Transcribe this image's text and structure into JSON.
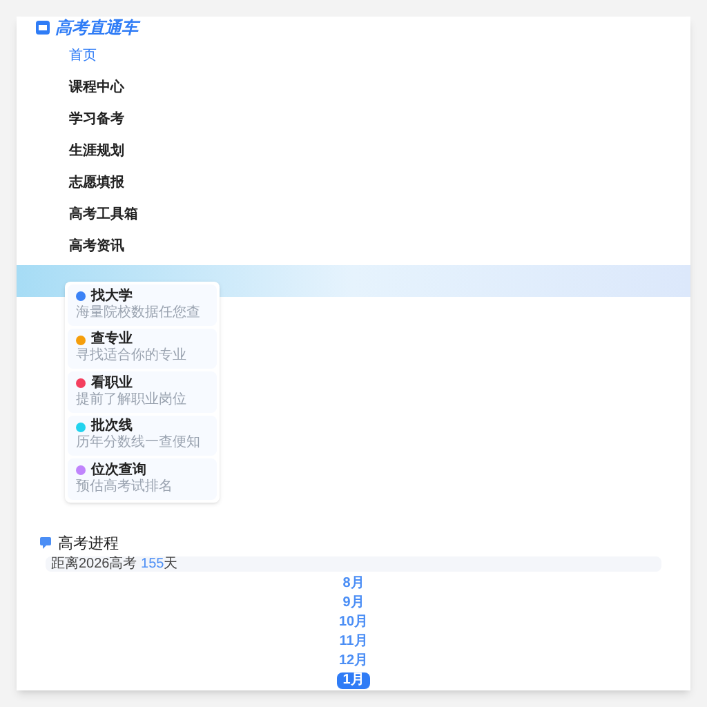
{
  "logo": {
    "text": "高考直通车"
  },
  "nav": [
    {
      "label": "首页",
      "selected": true
    },
    {
      "label": "课程中心",
      "selected": false
    },
    {
      "label": "学习备考",
      "selected": false
    },
    {
      "label": "生涯规划",
      "selected": false
    },
    {
      "label": "志愿填报",
      "selected": false
    },
    {
      "label": "高考工具箱",
      "selected": false
    },
    {
      "label": "高考资讯",
      "selected": false
    }
  ],
  "tools": [
    {
      "title": "找大学",
      "subtitle": "海量院校数据任您查",
      "color": "#3b82f6"
    },
    {
      "title": "查专业",
      "subtitle": "寻找适合你的专业",
      "color": "#f59e0b"
    },
    {
      "title": "看职业",
      "subtitle": "提前了解职业岗位",
      "color": "#f43f5e"
    },
    {
      "title": "批次线",
      "subtitle": "历年分数线一查便知",
      "color": "#22d3ee"
    },
    {
      "title": "位次查询",
      "subtitle": "预估高考试排名",
      "color": "#c084fc"
    }
  ],
  "progress": {
    "title": "高考进程",
    "countdown_prefix": "距离2026高考",
    "days": "155",
    "countdown_suffix": "天",
    "months": [
      {
        "label": "8月",
        "selected": false
      },
      {
        "label": "9月",
        "selected": false
      },
      {
        "label": "10月",
        "selected": false
      },
      {
        "label": "11月",
        "selected": false
      },
      {
        "label": "12月",
        "selected": false
      },
      {
        "label": "1月",
        "selected": true
      }
    ]
  }
}
